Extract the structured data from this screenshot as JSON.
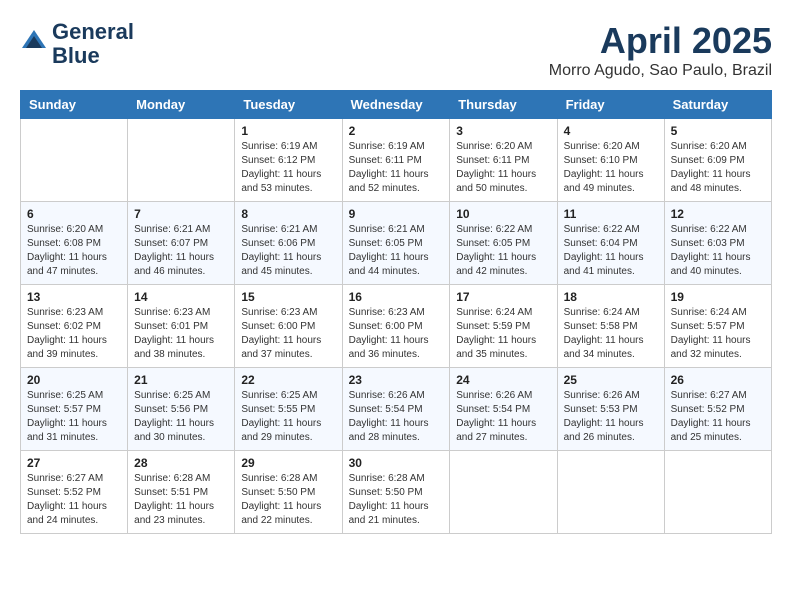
{
  "header": {
    "logo_line1": "General",
    "logo_line2": "Blue",
    "title": "April 2025",
    "subtitle": "Morro Agudo, Sao Paulo, Brazil"
  },
  "weekdays": [
    "Sunday",
    "Monday",
    "Tuesday",
    "Wednesday",
    "Thursday",
    "Friday",
    "Saturday"
  ],
  "weeks": [
    [
      {
        "day": "",
        "info": ""
      },
      {
        "day": "",
        "info": ""
      },
      {
        "day": "1",
        "info": "Sunrise: 6:19 AM\nSunset: 6:12 PM\nDaylight: 11 hours and 53 minutes."
      },
      {
        "day": "2",
        "info": "Sunrise: 6:19 AM\nSunset: 6:11 PM\nDaylight: 11 hours and 52 minutes."
      },
      {
        "day": "3",
        "info": "Sunrise: 6:20 AM\nSunset: 6:11 PM\nDaylight: 11 hours and 50 minutes."
      },
      {
        "day": "4",
        "info": "Sunrise: 6:20 AM\nSunset: 6:10 PM\nDaylight: 11 hours and 49 minutes."
      },
      {
        "day": "5",
        "info": "Sunrise: 6:20 AM\nSunset: 6:09 PM\nDaylight: 11 hours and 48 minutes."
      }
    ],
    [
      {
        "day": "6",
        "info": "Sunrise: 6:20 AM\nSunset: 6:08 PM\nDaylight: 11 hours and 47 minutes."
      },
      {
        "day": "7",
        "info": "Sunrise: 6:21 AM\nSunset: 6:07 PM\nDaylight: 11 hours and 46 minutes."
      },
      {
        "day": "8",
        "info": "Sunrise: 6:21 AM\nSunset: 6:06 PM\nDaylight: 11 hours and 45 minutes."
      },
      {
        "day": "9",
        "info": "Sunrise: 6:21 AM\nSunset: 6:05 PM\nDaylight: 11 hours and 44 minutes."
      },
      {
        "day": "10",
        "info": "Sunrise: 6:22 AM\nSunset: 6:05 PM\nDaylight: 11 hours and 42 minutes."
      },
      {
        "day": "11",
        "info": "Sunrise: 6:22 AM\nSunset: 6:04 PM\nDaylight: 11 hours and 41 minutes."
      },
      {
        "day": "12",
        "info": "Sunrise: 6:22 AM\nSunset: 6:03 PM\nDaylight: 11 hours and 40 minutes."
      }
    ],
    [
      {
        "day": "13",
        "info": "Sunrise: 6:23 AM\nSunset: 6:02 PM\nDaylight: 11 hours and 39 minutes."
      },
      {
        "day": "14",
        "info": "Sunrise: 6:23 AM\nSunset: 6:01 PM\nDaylight: 11 hours and 38 minutes."
      },
      {
        "day": "15",
        "info": "Sunrise: 6:23 AM\nSunset: 6:00 PM\nDaylight: 11 hours and 37 minutes."
      },
      {
        "day": "16",
        "info": "Sunrise: 6:23 AM\nSunset: 6:00 PM\nDaylight: 11 hours and 36 minutes."
      },
      {
        "day": "17",
        "info": "Sunrise: 6:24 AM\nSunset: 5:59 PM\nDaylight: 11 hours and 35 minutes."
      },
      {
        "day": "18",
        "info": "Sunrise: 6:24 AM\nSunset: 5:58 PM\nDaylight: 11 hours and 34 minutes."
      },
      {
        "day": "19",
        "info": "Sunrise: 6:24 AM\nSunset: 5:57 PM\nDaylight: 11 hours and 32 minutes."
      }
    ],
    [
      {
        "day": "20",
        "info": "Sunrise: 6:25 AM\nSunset: 5:57 PM\nDaylight: 11 hours and 31 minutes."
      },
      {
        "day": "21",
        "info": "Sunrise: 6:25 AM\nSunset: 5:56 PM\nDaylight: 11 hours and 30 minutes."
      },
      {
        "day": "22",
        "info": "Sunrise: 6:25 AM\nSunset: 5:55 PM\nDaylight: 11 hours and 29 minutes."
      },
      {
        "day": "23",
        "info": "Sunrise: 6:26 AM\nSunset: 5:54 PM\nDaylight: 11 hours and 28 minutes."
      },
      {
        "day": "24",
        "info": "Sunrise: 6:26 AM\nSunset: 5:54 PM\nDaylight: 11 hours and 27 minutes."
      },
      {
        "day": "25",
        "info": "Sunrise: 6:26 AM\nSunset: 5:53 PM\nDaylight: 11 hours and 26 minutes."
      },
      {
        "day": "26",
        "info": "Sunrise: 6:27 AM\nSunset: 5:52 PM\nDaylight: 11 hours and 25 minutes."
      }
    ],
    [
      {
        "day": "27",
        "info": "Sunrise: 6:27 AM\nSunset: 5:52 PM\nDaylight: 11 hours and 24 minutes."
      },
      {
        "day": "28",
        "info": "Sunrise: 6:28 AM\nSunset: 5:51 PM\nDaylight: 11 hours and 23 minutes."
      },
      {
        "day": "29",
        "info": "Sunrise: 6:28 AM\nSunset: 5:50 PM\nDaylight: 11 hours and 22 minutes."
      },
      {
        "day": "30",
        "info": "Sunrise: 6:28 AM\nSunset: 5:50 PM\nDaylight: 11 hours and 21 minutes."
      },
      {
        "day": "",
        "info": ""
      },
      {
        "day": "",
        "info": ""
      },
      {
        "day": "",
        "info": ""
      }
    ]
  ]
}
